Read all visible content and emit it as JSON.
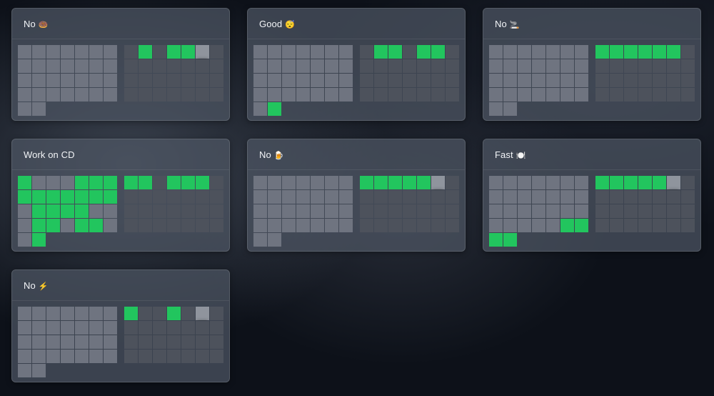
{
  "colors": {
    "done": "#22c55e",
    "past_empty": "#6f7480",
    "future_empty": "#4d525c",
    "today": "#8f949d",
    "card_bg": "#4e5664",
    "background": "#0d1119"
  },
  "habits": [
    {
      "name": "No",
      "emoji": "🍩",
      "month1_done": [],
      "month2_done": [
        1,
        3,
        4
      ],
      "month2_today": 5
    },
    {
      "name": "Good",
      "emoji": "😴",
      "month1_done": [
        29
      ],
      "month2_done": [
        1,
        2,
        4,
        5
      ],
      "month2_today": null
    },
    {
      "name": "No",
      "emoji": "🚬",
      "month1_done": [],
      "month2_done": [
        0,
        1,
        2,
        3,
        4,
        5
      ],
      "month2_today": null
    },
    {
      "name": "Work on CD",
      "emoji": "",
      "month1_done": [
        0,
        4,
        5,
        6,
        7,
        8,
        9,
        10,
        11,
        12,
        13,
        15,
        16,
        17,
        18,
        22,
        23,
        25,
        26,
        29
      ],
      "month2_done": [
        0,
        1,
        3,
        4,
        5
      ],
      "month2_today": null
    },
    {
      "name": "No",
      "emoji": "🍺",
      "month1_done": [],
      "month2_done": [
        0,
        1,
        2,
        3,
        4
      ],
      "month2_today": 5
    },
    {
      "name": "Fast",
      "emoji": "🍽️",
      "month1_done": [
        26,
        27,
        28,
        29
      ],
      "month2_done": [
        0,
        1,
        2,
        3,
        4
      ],
      "month2_today": 5
    },
    {
      "name": "No",
      "emoji": "⚡",
      "month1_done": [],
      "month2_done": [
        0,
        3
      ],
      "month2_today": 5
    }
  ]
}
